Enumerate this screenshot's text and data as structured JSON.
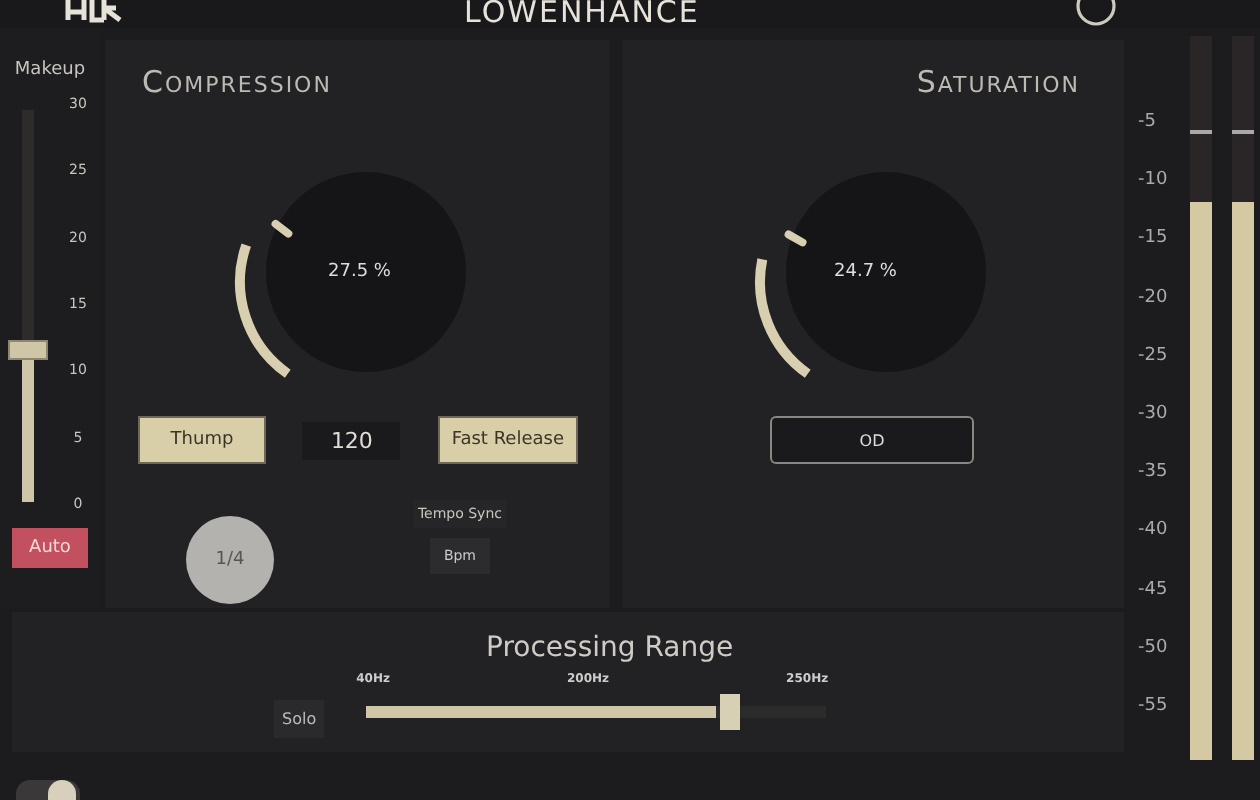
{
  "header": {
    "title": "LOWENHANCE"
  },
  "makeup": {
    "label": "Makeup",
    "scale": [
      "30",
      "25",
      "20",
      "15",
      "10",
      "5",
      "0"
    ],
    "level": 0.37,
    "auto_button": {
      "label": "Auto",
      "on": true
    }
  },
  "compression": {
    "title": "Compression",
    "knob": {
      "reading": "27.5 %"
    },
    "buttons": [
      {
        "label": "Thump",
        "on": true
      },
      {
        "label": "Fast Release",
        "on": true
      }
    ],
    "tempo": "120",
    "division_knob": {
      "reading": "1/4"
    },
    "tempo_sync": {
      "label": "Tempo Sync"
    },
    "bpm_button": {
      "label": "Bpm"
    }
  },
  "saturation": {
    "title": "Saturation",
    "knob": {
      "reading": "24.7 %"
    },
    "mode_button": {
      "label": "OD"
    }
  },
  "processing_range": {
    "title": "Processing Range",
    "solo_button": {
      "label": "Solo",
      "on": false
    },
    "ticks": [
      "40Hz",
      "200Hz",
      "250Hz"
    ],
    "level": 0.76
  },
  "meter": {
    "scale": [
      "-5",
      "-10",
      "-15",
      "-20",
      "-25",
      "-30",
      "-35",
      "-40",
      "-45",
      "-50",
      "-55"
    ],
    "channels": [
      {
        "level": 0.77
      },
      {
        "level": 0.77
      }
    ]
  },
  "footer": {
    "toggle": {
      "on": true
    }
  }
}
